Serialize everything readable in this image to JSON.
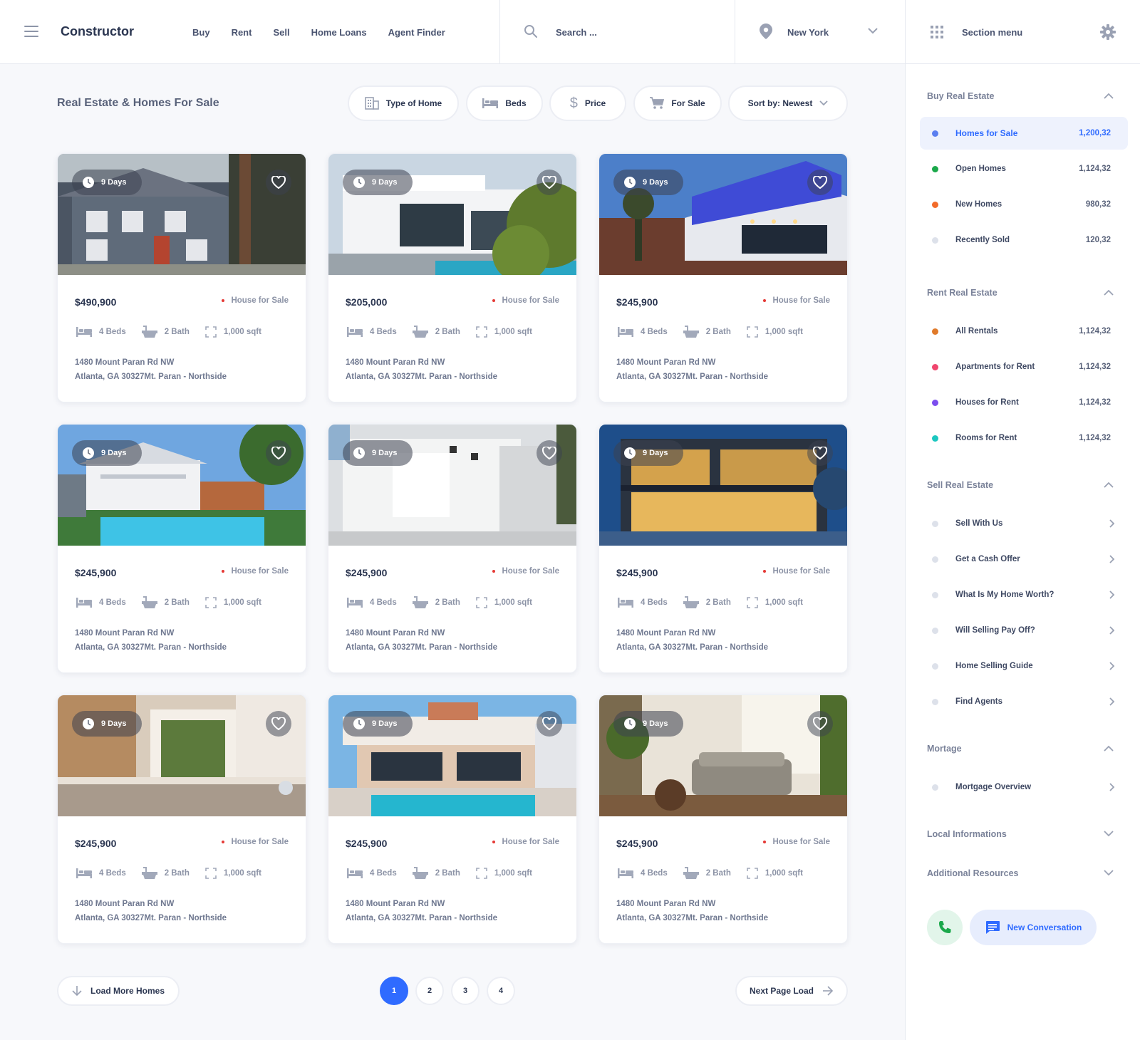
{
  "header": {
    "brand": "Constructor",
    "nav": [
      "Buy",
      "Rent",
      "Sell",
      "Home Loans",
      "Agent Finder"
    ],
    "search_placeholder": "Search ...",
    "location": "New York",
    "section_menu": "Section menu"
  },
  "main": {
    "title": "Real Estate & Homes For Sale",
    "filters": {
      "type": "Type of Home",
      "beds": "Beds",
      "price": "Price",
      "sale": "For Sale",
      "sort": "Sort by: Newest"
    },
    "listings": [
      {
        "days": "9 Days",
        "price": "$490,900",
        "status": "House for Sale",
        "beds": "4 Beds",
        "bath": "2 Bath",
        "area": "1,000 sqft",
        "address1": "1480 Mount Paran Rd NW",
        "address2": "Atlanta, GA 30327Mt. Paran - Northside"
      },
      {
        "days": "9 Days",
        "price": "$205,000",
        "status": "House for Sale",
        "beds": "4 Beds",
        "bath": "2 Bath",
        "area": "1,000 sqft",
        "address1": "1480 Mount Paran Rd NW",
        "address2": "Atlanta, GA 30327Mt. Paran - Northside"
      },
      {
        "days": "9 Days",
        "price": "$245,900",
        "status": "House for Sale",
        "beds": "4 Beds",
        "bath": "2 Bath",
        "area": "1,000 sqft",
        "address1": "1480 Mount Paran Rd NW",
        "address2": "Atlanta, GA 30327Mt. Paran - Northside"
      },
      {
        "days": "9 Days",
        "price": "$245,900",
        "status": "House for Sale",
        "beds": "4 Beds",
        "bath": "2 Bath",
        "area": "1,000 sqft",
        "address1": "1480 Mount Paran Rd NW",
        "address2": "Atlanta, GA 30327Mt. Paran - Northside"
      },
      {
        "days": "9 Days",
        "price": "$245,900",
        "status": "House for Sale",
        "beds": "4 Beds",
        "bath": "2 Bath",
        "area": "1,000 sqft",
        "address1": "1480 Mount Paran Rd NW",
        "address2": "Atlanta, GA 30327Mt. Paran - Northside"
      },
      {
        "days": "9 Days",
        "price": "$245,900",
        "status": "House for Sale",
        "beds": "4 Beds",
        "bath": "2 Bath",
        "area": "1,000 sqft",
        "address1": "1480 Mount Paran Rd NW",
        "address2": "Atlanta, GA 30327Mt. Paran - Northside"
      },
      {
        "days": "9 Days",
        "price": "$245,900",
        "status": "House for Sale",
        "beds": "4 Beds",
        "bath": "2 Bath",
        "area": "1,000 sqft",
        "address1": "1480 Mount Paran Rd NW",
        "address2": "Atlanta, GA 30327Mt. Paran - Northside"
      },
      {
        "days": "9 Days",
        "price": "$245,900",
        "status": "House for Sale",
        "beds": "4 Beds",
        "bath": "2 Bath",
        "area": "1,000 sqft",
        "address1": "1480 Mount Paran Rd NW",
        "address2": "Atlanta, GA 30327Mt. Paran - Northside"
      },
      {
        "days": "9 Days",
        "price": "$245,900",
        "status": "House for Sale",
        "beds": "4 Beds",
        "bath": "2 Bath",
        "area": "1,000 sqft",
        "address1": "1480 Mount Paran Rd NW",
        "address2": "Atlanta, GA 30327Mt. Paran - Northside"
      }
    ],
    "load_more": "Load More Homes",
    "pages": [
      "1",
      "2",
      "3",
      "4"
    ],
    "next_page": "Next Page Load"
  },
  "sidebar": {
    "buy_heading": "Buy Real Estate",
    "buy_items": [
      {
        "label": "Homes for Sale",
        "count": "1,200,32",
        "color": "#5b7ff0"
      },
      {
        "label": "Open Homes",
        "count": "1,124,32",
        "color": "#1aa84a"
      },
      {
        "label": "New Homes",
        "count": "980,32",
        "color": "#f26b2a"
      },
      {
        "label": "Recently Sold",
        "count": "120,32",
        "color": "#dde1ea"
      }
    ],
    "rent_heading": "Rent Real Estate",
    "rent_items": [
      {
        "label": "All Rentals",
        "count": "1,124,32",
        "color": "#e07a2a"
      },
      {
        "label": "Apartments for Rent",
        "count": "1,124,32",
        "color": "#f0466e"
      },
      {
        "label": "Houses for Rent",
        "count": "1,124,32",
        "color": "#7c4dee"
      },
      {
        "label": "Rooms for Rent",
        "count": "1,124,32",
        "color": "#1cc7c0"
      }
    ],
    "sell_heading": "Sell Real Estate",
    "sell_items": [
      "Sell With Us",
      "Get a Cash Offer",
      "What Is My Home Worth?",
      "Will Selling Pay Off?",
      "Home Selling Guide",
      "Find Agents"
    ],
    "mortgage_heading": "Mortage",
    "mortgage_items": [
      "Mortgage Overview"
    ],
    "local_heading": "Local Informations",
    "additional_heading": "Additional Resources",
    "new_conversation": "New Conversation"
  }
}
